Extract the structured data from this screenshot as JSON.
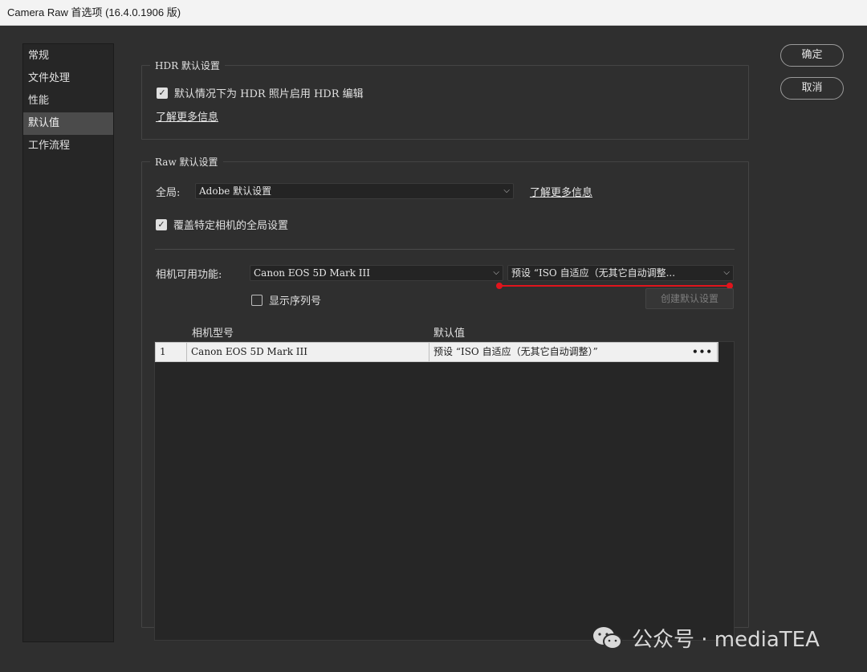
{
  "window": {
    "title": "Camera Raw 首选项 (16.4.0.1906 版)"
  },
  "sidebar": {
    "items": [
      {
        "label": "常规"
      },
      {
        "label": "文件处理"
      },
      {
        "label": "性能"
      },
      {
        "label": "默认值",
        "active": true
      },
      {
        "label": "工作流程"
      }
    ]
  },
  "buttons": {
    "ok": "确定",
    "cancel": "取消"
  },
  "hdr": {
    "title": "HDR 默认设置",
    "checkbox_label": "默认情况下为 HDR 照片启用 HDR 编辑",
    "checkbox_checked": true,
    "learn_more": "了解更多信息"
  },
  "raw": {
    "title": "Raw 默认设置",
    "global_label": "全局:",
    "global_value": "Adobe 默认设置",
    "learn_more": "了解更多信息",
    "override_label": "覆盖特定相机的全局设置",
    "override_checked": true,
    "camera_label": "相机可用功能:",
    "camera_value": "Canon EOS 5D Mark III",
    "preset_value": "预设 “ISO 自适应（无其它自动调整...",
    "serial_label": "显示序列号",
    "serial_checked": false,
    "create_button": "创建默认设置"
  },
  "table": {
    "headers": [
      "相机型号",
      "默认值"
    ],
    "rows": [
      {
        "index": "1",
        "model": "Canon EOS 5D Mark III",
        "default": "预设 “ISO 自适应（无其它自动调整）”",
        "more": "•••"
      }
    ]
  },
  "icons": {
    "chevron": "chevron-down-icon",
    "check": "checkmark-icon",
    "more": "more-options-icon"
  },
  "accent_colors": {
    "annotation_red": "#e0141c"
  },
  "watermark": {
    "text": "公众号 · mediaTEA"
  }
}
